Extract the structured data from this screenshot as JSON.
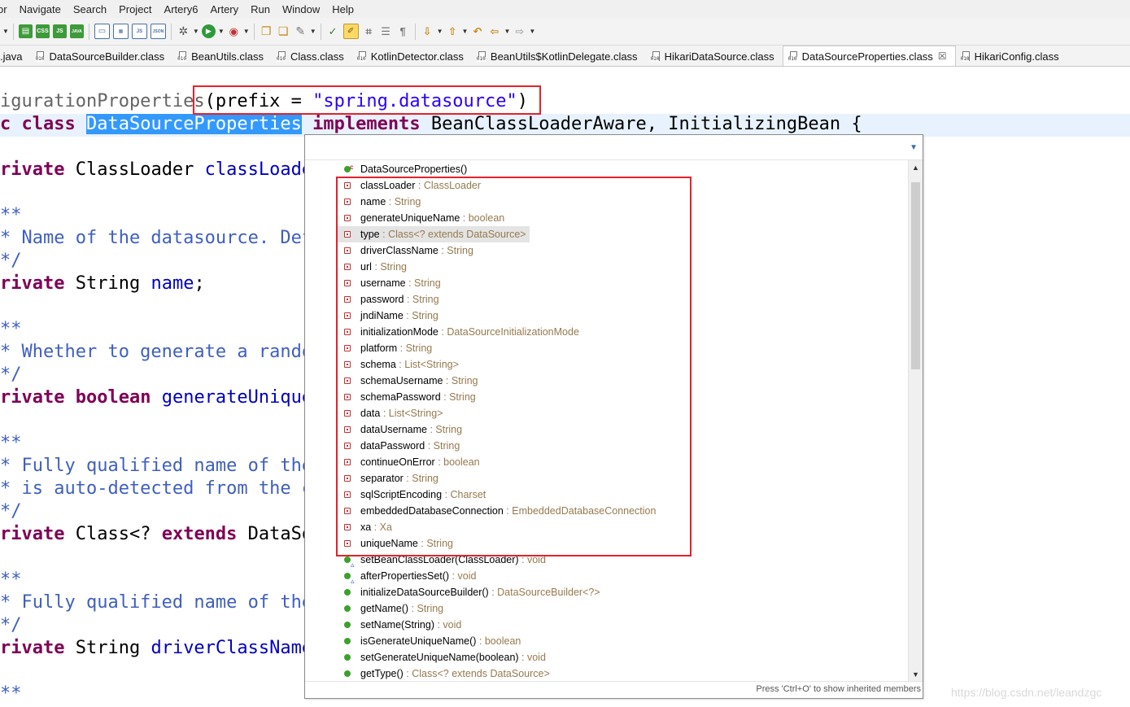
{
  "menubar": [
    "or",
    "Navigate",
    "Search",
    "Project",
    "Artery6",
    "Artery",
    "Run",
    "Window",
    "Help"
  ],
  "tabs": [
    {
      "label": ".java",
      "icon": false
    },
    {
      "label": "DataSourceBuilder.class",
      "icon": true
    },
    {
      "label": "BeanUtils.class",
      "icon": true
    },
    {
      "label": "Class.class",
      "icon": true
    },
    {
      "label": "KotlinDetector.class",
      "icon": true
    },
    {
      "label": "BeanUtils$KotlinDelegate.class",
      "icon": true
    },
    {
      "label": "HikariDataSource.class",
      "icon": true
    },
    {
      "label": "DataSourceProperties.class",
      "icon": true,
      "active": true,
      "close": "☒"
    },
    {
      "label": "HikariConfig.class",
      "icon": true
    }
  ],
  "toolbar": {
    "labels": [
      "CSS",
      "JS",
      "JAVA",
      "JS",
      "JSON"
    ]
  },
  "code": {
    "line1_prefix": "igurationProperties",
    "line1_arg": "(prefix = ",
    "line1_str": "\"spring.datasource\"",
    "line1_close": ")",
    "line2_c": "c ",
    "line2_class": "class",
    "line2_name": "DataSourceProperties",
    "line2_impl": "implements",
    "line2_rest": " BeanClassLoaderAware, InitializingBean {",
    "l3_kw": "rivate",
    "l3_type": " ClassLoader ",
    "l3_field": "classLoade",
    "c1_open": "**",
    "c1_text": "* Name of the datasource. Def",
    "c1_close": "*/",
    "l4_kw": "rivate",
    "l4_type": " String ",
    "l4_field": "name",
    "l4_end": ";",
    "c2_open": "**",
    "c2_text": "* Whether to generate a rando",
    "c2_close": "*/",
    "l5_kw": "rivate",
    "l5_kw2": "boolean",
    "l5_field": "generateUnique",
    "c3_open": "**",
    "c3_text1": "* Fully qualified name of the",
    "c3_text2": "* is auto-detected from the c",
    "c3_close": "*/",
    "l6_kw": "rivate",
    "l6_type": " Class<? ",
    "l6_kw2": "extends",
    "l6_rest": " DataSo",
    "c4_open": "**",
    "c4_text": "* Fully qualified name of the",
    "c4_close": "*/",
    "l7_kw": "rivate",
    "l7_type": " String ",
    "l7_field": "driverClassName",
    "c5_open": "**"
  },
  "outline": {
    "items": [
      {
        "name": "DataSourceProperties()",
        "type": "",
        "icon": "constructor"
      },
      {
        "name": "classLoader",
        "type": "ClassLoader",
        "icon": "private-field"
      },
      {
        "name": "name",
        "type": "String",
        "icon": "private-field"
      },
      {
        "name": "generateUniqueName",
        "type": "boolean",
        "icon": "private-field"
      },
      {
        "name": "type",
        "type": "Class<? extends DataSource>",
        "icon": "private-field",
        "selected": true
      },
      {
        "name": "driverClassName",
        "type": "String",
        "icon": "private-field"
      },
      {
        "name": "url",
        "type": "String",
        "icon": "private-field"
      },
      {
        "name": "username",
        "type": "String",
        "icon": "private-field"
      },
      {
        "name": "password",
        "type": "String",
        "icon": "private-field"
      },
      {
        "name": "jndiName",
        "type": "String",
        "icon": "private-field"
      },
      {
        "name": "initializationMode",
        "type": "DataSourceInitializationMode",
        "icon": "private-field"
      },
      {
        "name": "platform",
        "type": "String",
        "icon": "private-field"
      },
      {
        "name": "schema",
        "type": "List<String>",
        "icon": "private-field"
      },
      {
        "name": "schemaUsername",
        "type": "String",
        "icon": "private-field"
      },
      {
        "name": "schemaPassword",
        "type": "String",
        "icon": "private-field"
      },
      {
        "name": "data",
        "type": "List<String>",
        "icon": "private-field"
      },
      {
        "name": "dataUsername",
        "type": "String",
        "icon": "private-field"
      },
      {
        "name": "dataPassword",
        "type": "String",
        "icon": "private-field"
      },
      {
        "name": "continueOnError",
        "type": "boolean",
        "icon": "private-field"
      },
      {
        "name": "separator",
        "type": "String",
        "icon": "private-field"
      },
      {
        "name": "sqlScriptEncoding",
        "type": "Charset",
        "icon": "private-field"
      },
      {
        "name": "embeddedDatabaseConnection",
        "type": "EmbeddedDatabaseConnection",
        "icon": "private-field"
      },
      {
        "name": "xa",
        "type": "Xa",
        "icon": "private-field"
      },
      {
        "name": "uniqueName",
        "type": "String",
        "icon": "private-field"
      },
      {
        "name": "setBeanClassLoader(ClassLoader)",
        "type": "void",
        "icon": "public-method-override"
      },
      {
        "name": "afterPropertiesSet()",
        "type": "void",
        "icon": "public-method-override"
      },
      {
        "name": "initializeDataSourceBuilder()",
        "type": "DataSourceBuilder<?>",
        "icon": "public-method"
      },
      {
        "name": "getName()",
        "type": "String",
        "icon": "public-method"
      },
      {
        "name": "setName(String)",
        "type": "void",
        "icon": "public-method"
      },
      {
        "name": "isGenerateUniqueName()",
        "type": "boolean",
        "icon": "public-method"
      },
      {
        "name": "setGenerateUniqueName(boolean)",
        "type": "void",
        "icon": "public-method"
      },
      {
        "name": "getType()",
        "type": "Class<? extends DataSource>",
        "icon": "public-method"
      }
    ],
    "status": "Press 'Ctrl+O' to show inherited members"
  },
  "watermark": "https://blog.csdn.net/leandzgc",
  "colors": {
    "highlight_box": "#e8202a",
    "keyword": "#7f0055",
    "string": "#2a00ff",
    "comment": "#3f5fbf",
    "field": "#0000c0",
    "selection": "#3399ff"
  }
}
